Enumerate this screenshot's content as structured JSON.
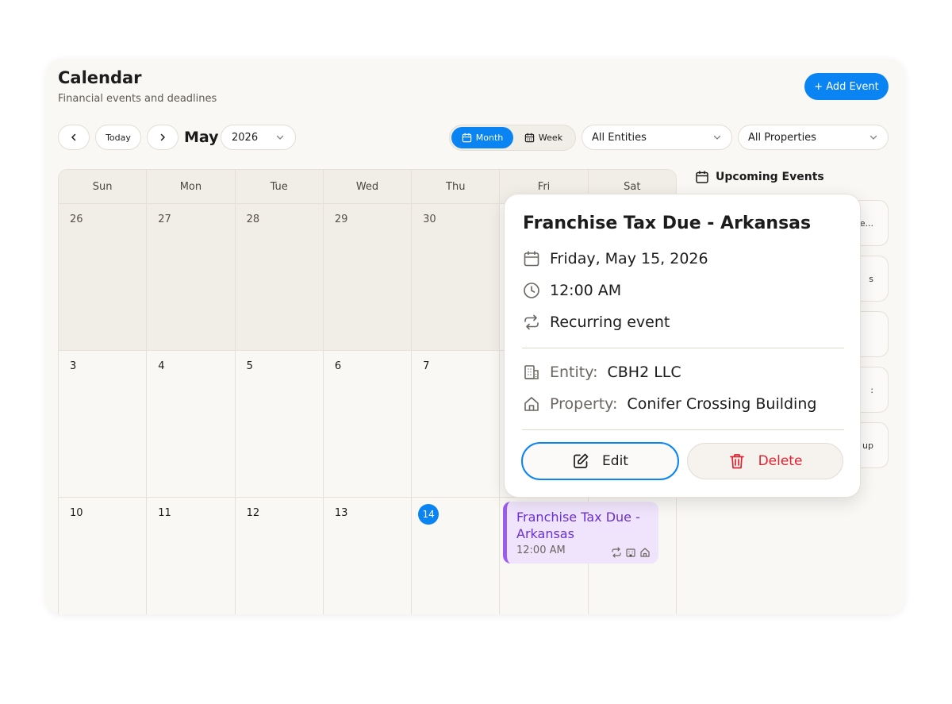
{
  "header": {
    "title": "Calendar",
    "subtitle": "Financial events and deadlines",
    "add_event_label": "+ Add Event"
  },
  "toolbar": {
    "today_label": "Today",
    "month_label": "May",
    "year_value": "2026",
    "view_month_label": "Month",
    "view_week_label": "Week",
    "active_view": "Month",
    "entities_value": "All Entities",
    "properties_value": "All Properties"
  },
  "calendar": {
    "weekdays": [
      "Sun",
      "Mon",
      "Tue",
      "Wed",
      "Thu",
      "Fri",
      "Sat"
    ],
    "weeks": [
      [
        "26",
        "27",
        "28",
        "29",
        "30",
        "",
        ""
      ],
      [
        "3",
        "4",
        "5",
        "6",
        "7",
        "",
        ""
      ],
      [
        "10",
        "11",
        "12",
        "13",
        "14",
        "",
        ""
      ]
    ],
    "today": "14",
    "event": {
      "title": "Franchise Tax Due - Arkansas",
      "time": "12:00 AM"
    }
  },
  "upcoming": {
    "title": "Upcoming Events",
    "fragments": [
      "e...",
      "s",
      "",
      ":",
      "up"
    ]
  },
  "popup": {
    "title": "Franchise Tax Due - Arkansas",
    "date": "Friday, May 15, 2026",
    "time": "12:00 AM",
    "recurrence": "Recurring event",
    "entity_label": "Entity:",
    "entity_value": "CBH2 LLC",
    "property_label": "Property:",
    "property_value": "Conifer Crossing Building",
    "edit_label": "Edit",
    "delete_label": "Delete"
  },
  "colors": {
    "accent": "#0a84f2",
    "event_bg": "#efe4fb",
    "event_border": "#9b5cf0",
    "event_text": "#6b2fd6",
    "danger": "#e0222f"
  }
}
